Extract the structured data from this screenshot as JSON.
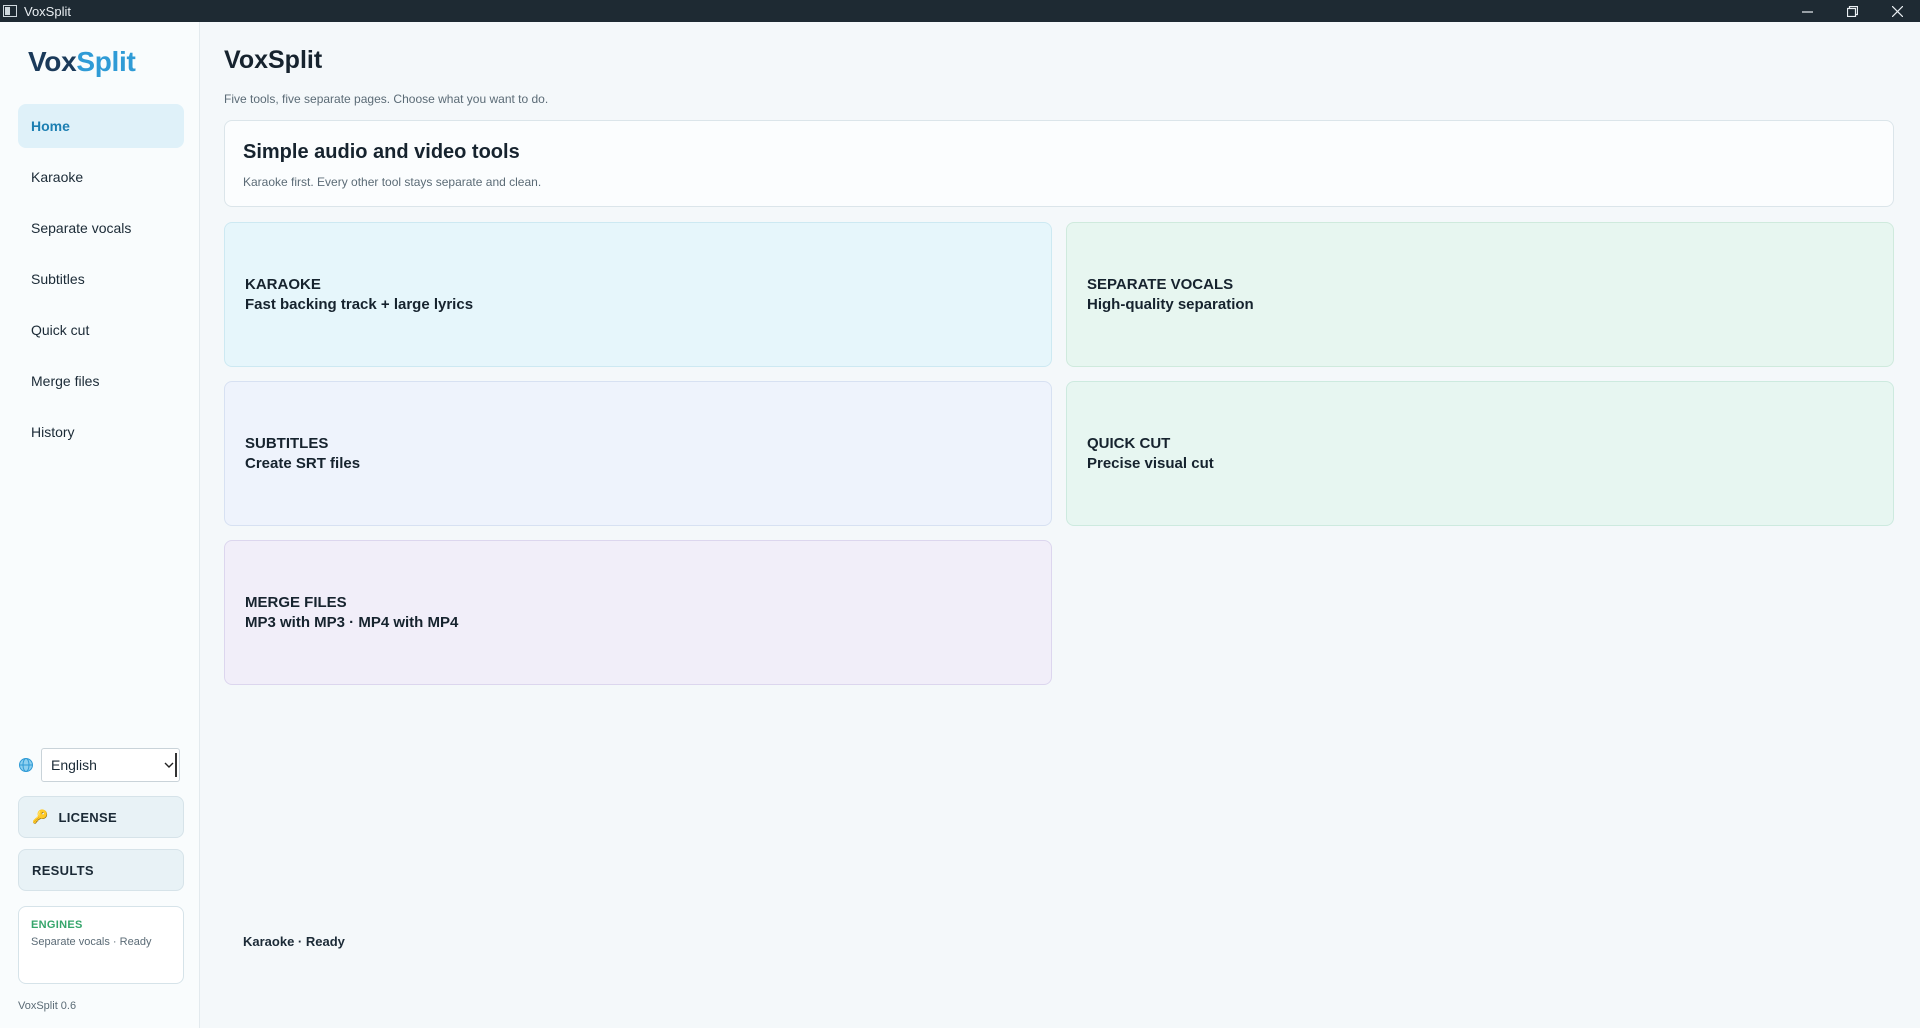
{
  "window": {
    "title": "VoxSplit",
    "controls": {
      "minimize": "─",
      "restore": "❐",
      "close": "✕"
    }
  },
  "sidebar": {
    "brand_a": "Vox",
    "brand_b": "Split",
    "items": [
      {
        "label": "Home",
        "active": true
      },
      {
        "label": "Karaoke"
      },
      {
        "label": "Separate vocals"
      },
      {
        "label": "Subtitles"
      },
      {
        "label": "Quick cut"
      },
      {
        "label": "Merge files"
      },
      {
        "label": "History"
      }
    ],
    "language": {
      "selected": "English"
    },
    "license_label": "LICENSE",
    "results_label": "RESULTS",
    "engines": {
      "label": "ENGINES",
      "main": "Karaoke · Ready",
      "sub": "Separate vocals · Ready"
    },
    "version": "VoxSplit 0.6"
  },
  "main": {
    "title": "VoxSplit",
    "subtitle": "Five tools, five separate pages. Choose what you want to do.",
    "hero": {
      "title": "Simple audio and video tools",
      "subtitle": "Karaoke first. Every other tool stays separate and clean."
    },
    "tiles": {
      "karaoke": {
        "name": "KARAOKE",
        "desc": "Fast backing track + large lyrics"
      },
      "vocals": {
        "name": "SEPARATE VOCALS",
        "desc": "High-quality separation"
      },
      "subtitles": {
        "name": "SUBTITLES",
        "desc": "Create SRT files"
      },
      "quickcut": {
        "name": "QUICK CUT",
        "desc": "Precise visual cut"
      },
      "merge": {
        "name": "MERGE FILES",
        "desc": "MP3 with MP3 · MP4 with MP4"
      }
    }
  },
  "colors": {
    "accent": "#2f9bd6",
    "brand_dark": "#1b3a5a",
    "ready_green": "#35a56b"
  }
}
